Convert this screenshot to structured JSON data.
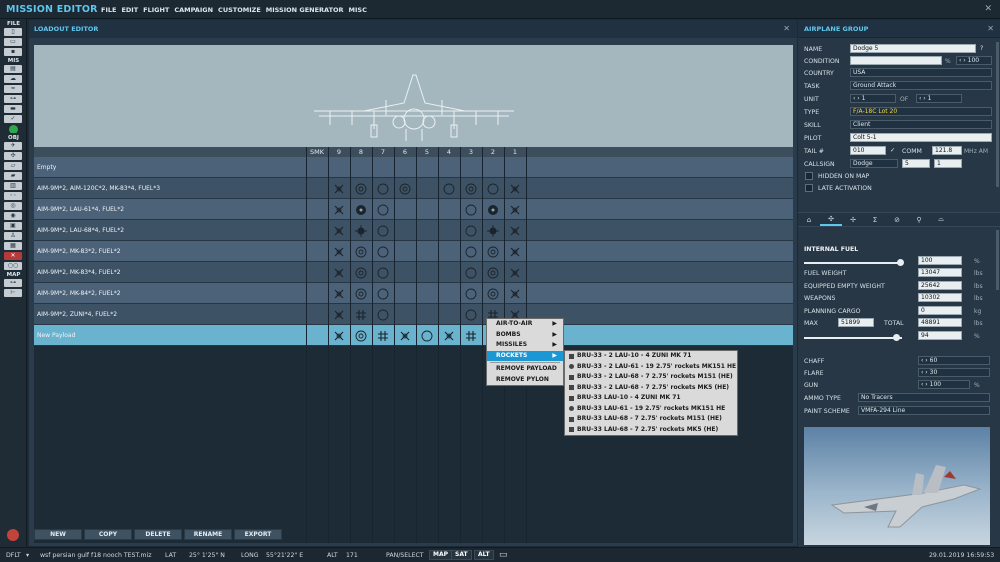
{
  "app": {
    "title": "MISSION EDITOR",
    "menus": [
      "FILE",
      "EDIT",
      "FLIGHT",
      "CAMPAIGN",
      "CUSTOMIZE",
      "MISSION GENERATOR",
      "MISC"
    ]
  },
  "toolbar": {
    "file_label": "FILE",
    "mis_label": "MIS",
    "obj_label": "OBJ",
    "map_label": "MAP"
  },
  "loadout": {
    "title": "LOADOUT EDITOR",
    "columns": [
      "SMK",
      "9",
      "8",
      "7",
      "6",
      "5",
      "4",
      "3",
      "2",
      "1"
    ],
    "empty_label": "Empty",
    "payloads": [
      {
        "name": "AIM-9M*2, AIM-120C*2, MK-83*4, FUEL*3",
        "icons": [
          "x",
          "t",
          "c",
          "t",
          "c",
          "t",
          "c",
          "x"
        ]
      },
      {
        "name": "AIM-9M*2, LAU-61*4, FUEL*2",
        "icons": [
          "x",
          "r",
          "c",
          "",
          "",
          "c",
          "r",
          "x"
        ]
      },
      {
        "name": "AIM-9M*2, LAU-68*4, FUEL*2",
        "icons": [
          "x",
          "s",
          "c",
          "",
          "",
          "c",
          "s",
          "x"
        ]
      },
      {
        "name": "AIM-9M*2, MK-83*2, FUEL*2",
        "icons": [
          "x",
          "t",
          "c",
          "",
          "",
          "c",
          "t",
          "x"
        ]
      },
      {
        "name": "AIM-9M*2, MK-83*4, FUEL*2",
        "icons": [
          "x",
          "t",
          "c",
          "",
          "",
          "c",
          "t",
          "x"
        ]
      },
      {
        "name": "AIM-9M*2, MK-84*2, FUEL*2",
        "icons": [
          "x",
          "t",
          "c",
          "",
          "",
          "c",
          "t",
          "x"
        ]
      },
      {
        "name": "AIM-9M*2, ZUNI*4, FUEL*2",
        "icons": [
          "x",
          "h",
          "c",
          "",
          "",
          "c",
          "h",
          "x"
        ]
      },
      {
        "name": "New Payload",
        "icons": [
          "x",
          "t",
          "h",
          "x",
          "c",
          "x",
          "h",
          "c",
          "x"
        ]
      }
    ],
    "buttons": [
      "NEW",
      "COPY",
      "DELETE",
      "RENAME",
      "EXPORT"
    ]
  },
  "context_menu": {
    "items": [
      {
        "label": "AIR-TO-AIR",
        "arrow": "▶"
      },
      {
        "label": "BOMBS",
        "arrow": "▶"
      },
      {
        "label": "MISSILES",
        "arrow": "▶"
      },
      {
        "label": "ROCKETS",
        "arrow": "▶"
      },
      {
        "label": "REMOVE PAYLOAD",
        "arrow": ""
      },
      {
        "label": "REMOVE PYLON",
        "arrow": ""
      }
    ],
    "rockets_submenu": [
      "BRU-33 - 2 LAU-10 - 4 ZUNI MK 71",
      "BRU-33 - 2 LAU-61 - 19 2.75' rockets MK151 HE",
      "BRU-33 - 2 LAU-68 - 7 2.75' rockets M151 (HE)",
      "BRU-33 - 2 LAU-68 - 7 2.75' rockets MK5 (HE)",
      "BRU-33 LAU-10 - 4 ZUNI MK 71",
      "BRU-33 LAU-61 - 19 2.75' rockets MK151 HE",
      "BRU-33 LAU-68 - 7 2.75' rockets M151 (HE)",
      "BRU-33 LAU-68 - 7 2.75' rockets MK5 (HE)"
    ]
  },
  "airplane_group": {
    "title": "AIRPLANE GROUP",
    "labels": {
      "name": "NAME",
      "condition": "CONDITION",
      "country": "COUNTRY",
      "task": "TASK",
      "unit": "UNIT",
      "of": "OF",
      "type": "TYPE",
      "skill": "SKILL",
      "pilot": "PILOT",
      "tail": "TAIL #",
      "comm": "COMM",
      "callsign": "CALLSIGN",
      "hidden": "HIDDEN ON MAP",
      "late": "LATE ACTIVATION"
    },
    "values": {
      "name": "Dodge 5",
      "condition_pct": "%",
      "condition_val": "100",
      "country": "USA",
      "task": "Ground Attack",
      "unit": "1",
      "unit_of": "1",
      "type": "F/A-18C Lot 20",
      "skill": "Client",
      "pilot": "Colt 5-1",
      "tail": "010",
      "comm_check": "✓",
      "comm_freq": "121.8",
      "comm_unit": "MHz AM",
      "callsign": "Dodge",
      "callsign_num": "5",
      "callsign_num2": "1"
    },
    "fuel": {
      "title": "INTERNAL FUEL",
      "fuel_pct": "100",
      "fuel_unit": "%",
      "fuel_weight_label": "FUEL WEIGHT",
      "fuel_weight": "13047",
      "empty_label": "EQUIPPED EMPTY WEIGHT",
      "empty": "25642",
      "weapons_label": "WEAPONS",
      "weapons": "10302",
      "cargo_label": "PLANNING CARGO",
      "cargo": "0",
      "max_label": "MAX",
      "max": "51899",
      "total_label": "TOTAL",
      "total": "48891",
      "lbs": "lbs",
      "kg": "kg",
      "pct": "%",
      "load_pct": "94",
      "fuel_level": 0.98,
      "load_level": 0.94
    },
    "stores": {
      "chaff_label": "CHAFF",
      "chaff": "60",
      "flare_label": "FLARE",
      "flare": "30",
      "gun_label": "GUN",
      "gun": "100",
      "gun_unit": "%",
      "ammo_label": "AMMO TYPE",
      "ammo": "No Tracers",
      "paint_label": "PAINT SCHEME",
      "paint": "VMFA-294 Line"
    }
  },
  "status": {
    "profile": "DFLT",
    "file": "wsf persian gulf f18 nooch TEST.miz",
    "lat_label": "LAT",
    "lat": "25° 1'25\" N",
    "long_label": "LONG",
    "long": "55°21'22\" E",
    "alt_label": "ALT",
    "alt": "171",
    "pan": "PAN/SELECT",
    "map": "MAP",
    "sat": "SAT",
    "alt_btn": "ALT",
    "datetime": "29.01.2019 16:59:53"
  }
}
